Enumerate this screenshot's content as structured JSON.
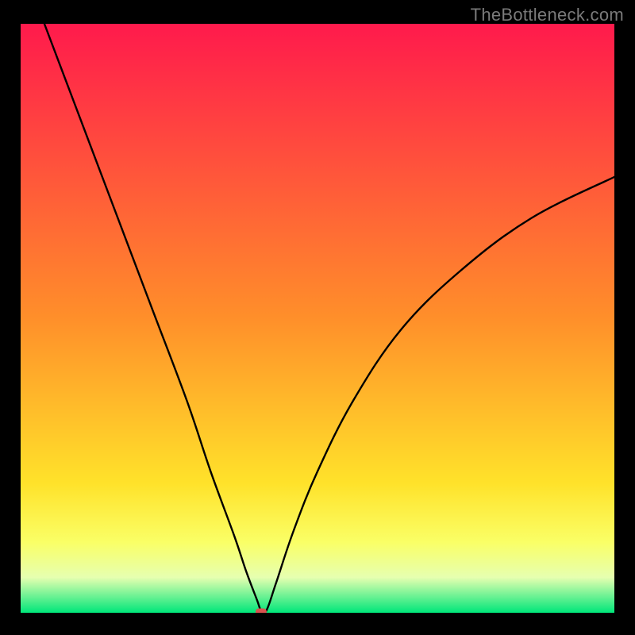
{
  "attribution": "TheBottleneck.com",
  "colors": {
    "top": "#ff1a4c",
    "mid1": "#ff8f2a",
    "mid2": "#ffe22a",
    "mid3": "#faff66",
    "mid4": "#e6ffb0",
    "bottom": "#00e67a",
    "curve": "#000000",
    "marker": "#d9534f",
    "frame": "#000000"
  },
  "chart_data": {
    "type": "line",
    "title": "",
    "xlabel": "",
    "ylabel": "",
    "xlim": [
      0,
      100
    ],
    "ylim": [
      0,
      100
    ],
    "curve": {
      "x": [
        4,
        10,
        16,
        22,
        28,
        32,
        36,
        38,
        39.8,
        40.5,
        41.4,
        43,
        46,
        50,
        56,
        64,
        74,
        86,
        100
      ],
      "y": [
        100,
        84,
        68,
        52,
        36,
        24,
        13,
        7,
        2.2,
        0.4,
        0.4,
        5,
        14,
        24,
        36,
        48,
        58,
        67,
        74
      ]
    },
    "marker": {
      "x": 40.5,
      "y": 0.2
    },
    "gradient_stops": [
      {
        "offset": 0,
        "y": 100
      },
      {
        "offset": 0.5,
        "y": 50
      },
      {
        "offset": 0.78,
        "y": 22
      },
      {
        "offset": 0.88,
        "y": 12
      },
      {
        "offset": 0.94,
        "y": 6
      },
      {
        "offset": 1.0,
        "y": 0
      }
    ]
  }
}
